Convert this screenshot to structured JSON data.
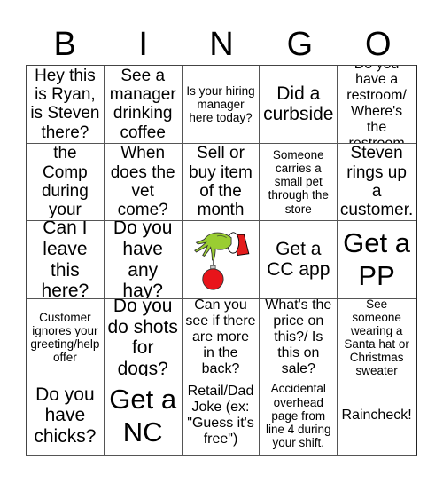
{
  "header": {
    "letters": [
      "B",
      "I",
      "N",
      "G",
      "O"
    ]
  },
  "board": {
    "cells": [
      "Hey this is Ryan, is Steven there?",
      "See a manager drinking coffee",
      "Is your hiring manager here today?",
      "Did a curbside",
      "Do you have a restroom/ Where's the restroom",
      "Stomp the Comp during your shift.",
      "When does the vet come?",
      "Sell or buy item of the month",
      "Someone carries a small pet through the store",
      "Steven rings up a customer.",
      "Can I leave this here?",
      "Do you have any hay?",
      "",
      "Get a CC app",
      "Get a PP",
      "Customer ignores your greeting/help offer",
      "Do you do shots for dogs?",
      "Can you see if there are more in the back?",
      "What's the price on this?/ Is this on sale?",
      "See someone wearing a Santa hat or Christmas sweater",
      "Do you have chicks?",
      "Get a NC",
      "Retail/Dad Joke (ex: \"Guess it's free\")",
      "Accidental overhead page from line 4 during your shift.",
      "Raincheck!"
    ],
    "free_space_icon": "grinch-hand-ornament-icon"
  },
  "colors": {
    "grinch_green": "#9acd32",
    "ornament_red": "#e8141a",
    "sleeve_red": "#e31b1b",
    "grid_line": "#555555"
  }
}
